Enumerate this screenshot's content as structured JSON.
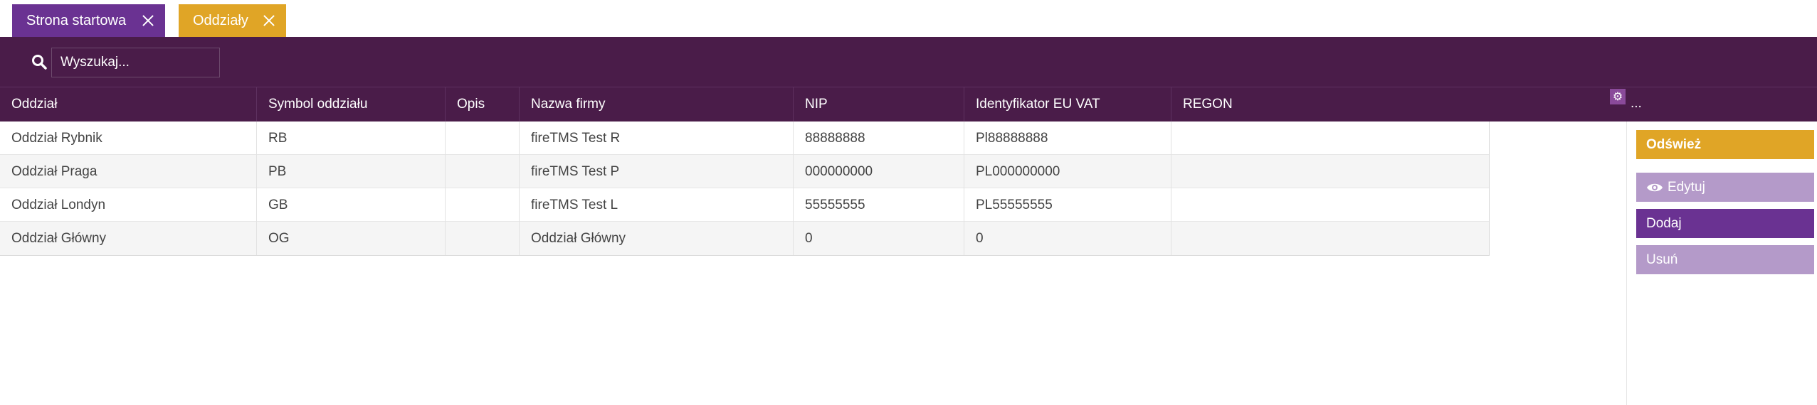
{
  "tabs": [
    {
      "label": "Strona startowa"
    },
    {
      "label": "Oddziały"
    }
  ],
  "search": {
    "placeholder": "Wyszukaj..."
  },
  "grid": {
    "columns": [
      "Oddział",
      "Symbol oddziału",
      "Opis",
      "Nazwa firmy",
      "NIP",
      "Identyfikator EU VAT",
      "REGON"
    ],
    "more_label": "...",
    "rows": [
      [
        "Oddział Rybnik",
        "RB",
        "",
        "fireTMS Test R",
        "88888888",
        "Pl88888888",
        ""
      ],
      [
        "Oddział Praga",
        "PB",
        "",
        "fireTMS Test P",
        "000000000",
        "PL000000000",
        ""
      ],
      [
        "Oddział Londyn",
        "GB",
        "",
        "fireTMS Test L",
        "55555555",
        "PL55555555",
        ""
      ],
      [
        "Oddział Główny",
        "OG",
        "",
        "Oddział Główny",
        "0",
        "0",
        ""
      ]
    ]
  },
  "actions": {
    "refresh": "Odśwież",
    "edit": "Edytuj",
    "add": "Dodaj",
    "delete": "Usuń"
  },
  "icons": {
    "search": "search-icon",
    "close": "close-icon",
    "gear": "gear-icon",
    "eye": "eye-icon"
  },
  "colors": {
    "primary_purple": "#6a3292",
    "dark_purple": "#4a1c49",
    "accent_orange": "#e0a526",
    "disabled_purple": "#b49ac9"
  }
}
